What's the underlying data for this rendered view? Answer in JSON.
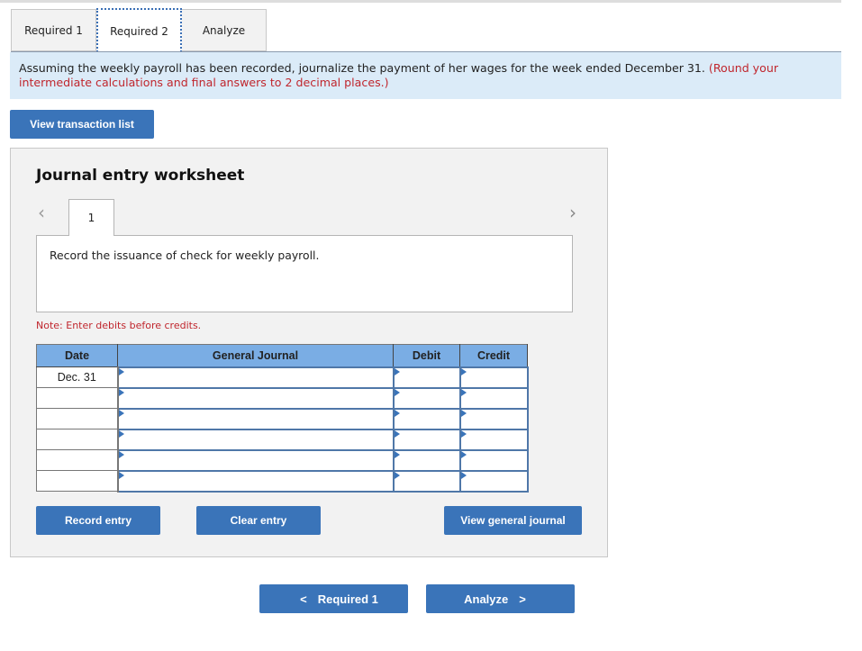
{
  "tabs": [
    {
      "label": "Required 1",
      "active": false
    },
    {
      "label": "Required 2",
      "active": true
    },
    {
      "label": "Analyze",
      "active": false
    }
  ],
  "instructions": {
    "text": "Assuming the weekly payroll has been recorded, journalize the payment of her wages for the week ended December 31. ",
    "note": "(Round your intermediate calculations and final answers to 2 decimal places.)"
  },
  "buttons": {
    "view_transaction_list": "View transaction list",
    "record_entry": "Record entry",
    "clear_entry": "Clear entry",
    "view_general_journal": "View general journal"
  },
  "worksheet": {
    "title": "Journal entry worksheet",
    "entry_number": "1",
    "prev_icon": "chevron-left-icon",
    "next_icon": "chevron-right-icon",
    "description": "Record the issuance of check for weekly payroll.",
    "note": "Note: Enter debits before credits.",
    "table": {
      "headers": [
        "Date",
        "General Journal",
        "Debit",
        "Credit"
      ],
      "rows": [
        {
          "date": "Dec. 31",
          "account": "",
          "debit": "",
          "credit": ""
        },
        {
          "date": "",
          "account": "",
          "debit": "",
          "credit": ""
        },
        {
          "date": "",
          "account": "",
          "debit": "",
          "credit": ""
        },
        {
          "date": "",
          "account": "",
          "debit": "",
          "credit": ""
        },
        {
          "date": "",
          "account": "",
          "debit": "",
          "credit": ""
        },
        {
          "date": "",
          "account": "",
          "debit": "",
          "credit": ""
        }
      ]
    }
  },
  "bottom_nav": {
    "prev_label": "Required 1",
    "next_label": "Analyze",
    "prev_glyph": "<",
    "next_glyph": ">"
  },
  "glyphs": {
    "chevron_left": "‹",
    "chevron_right": "›"
  },
  "colors": {
    "accent": "#3a74b9",
    "header_blue": "#7aade4",
    "instruction_bg": "#dbebf8",
    "warning_red": "#c0262d"
  }
}
